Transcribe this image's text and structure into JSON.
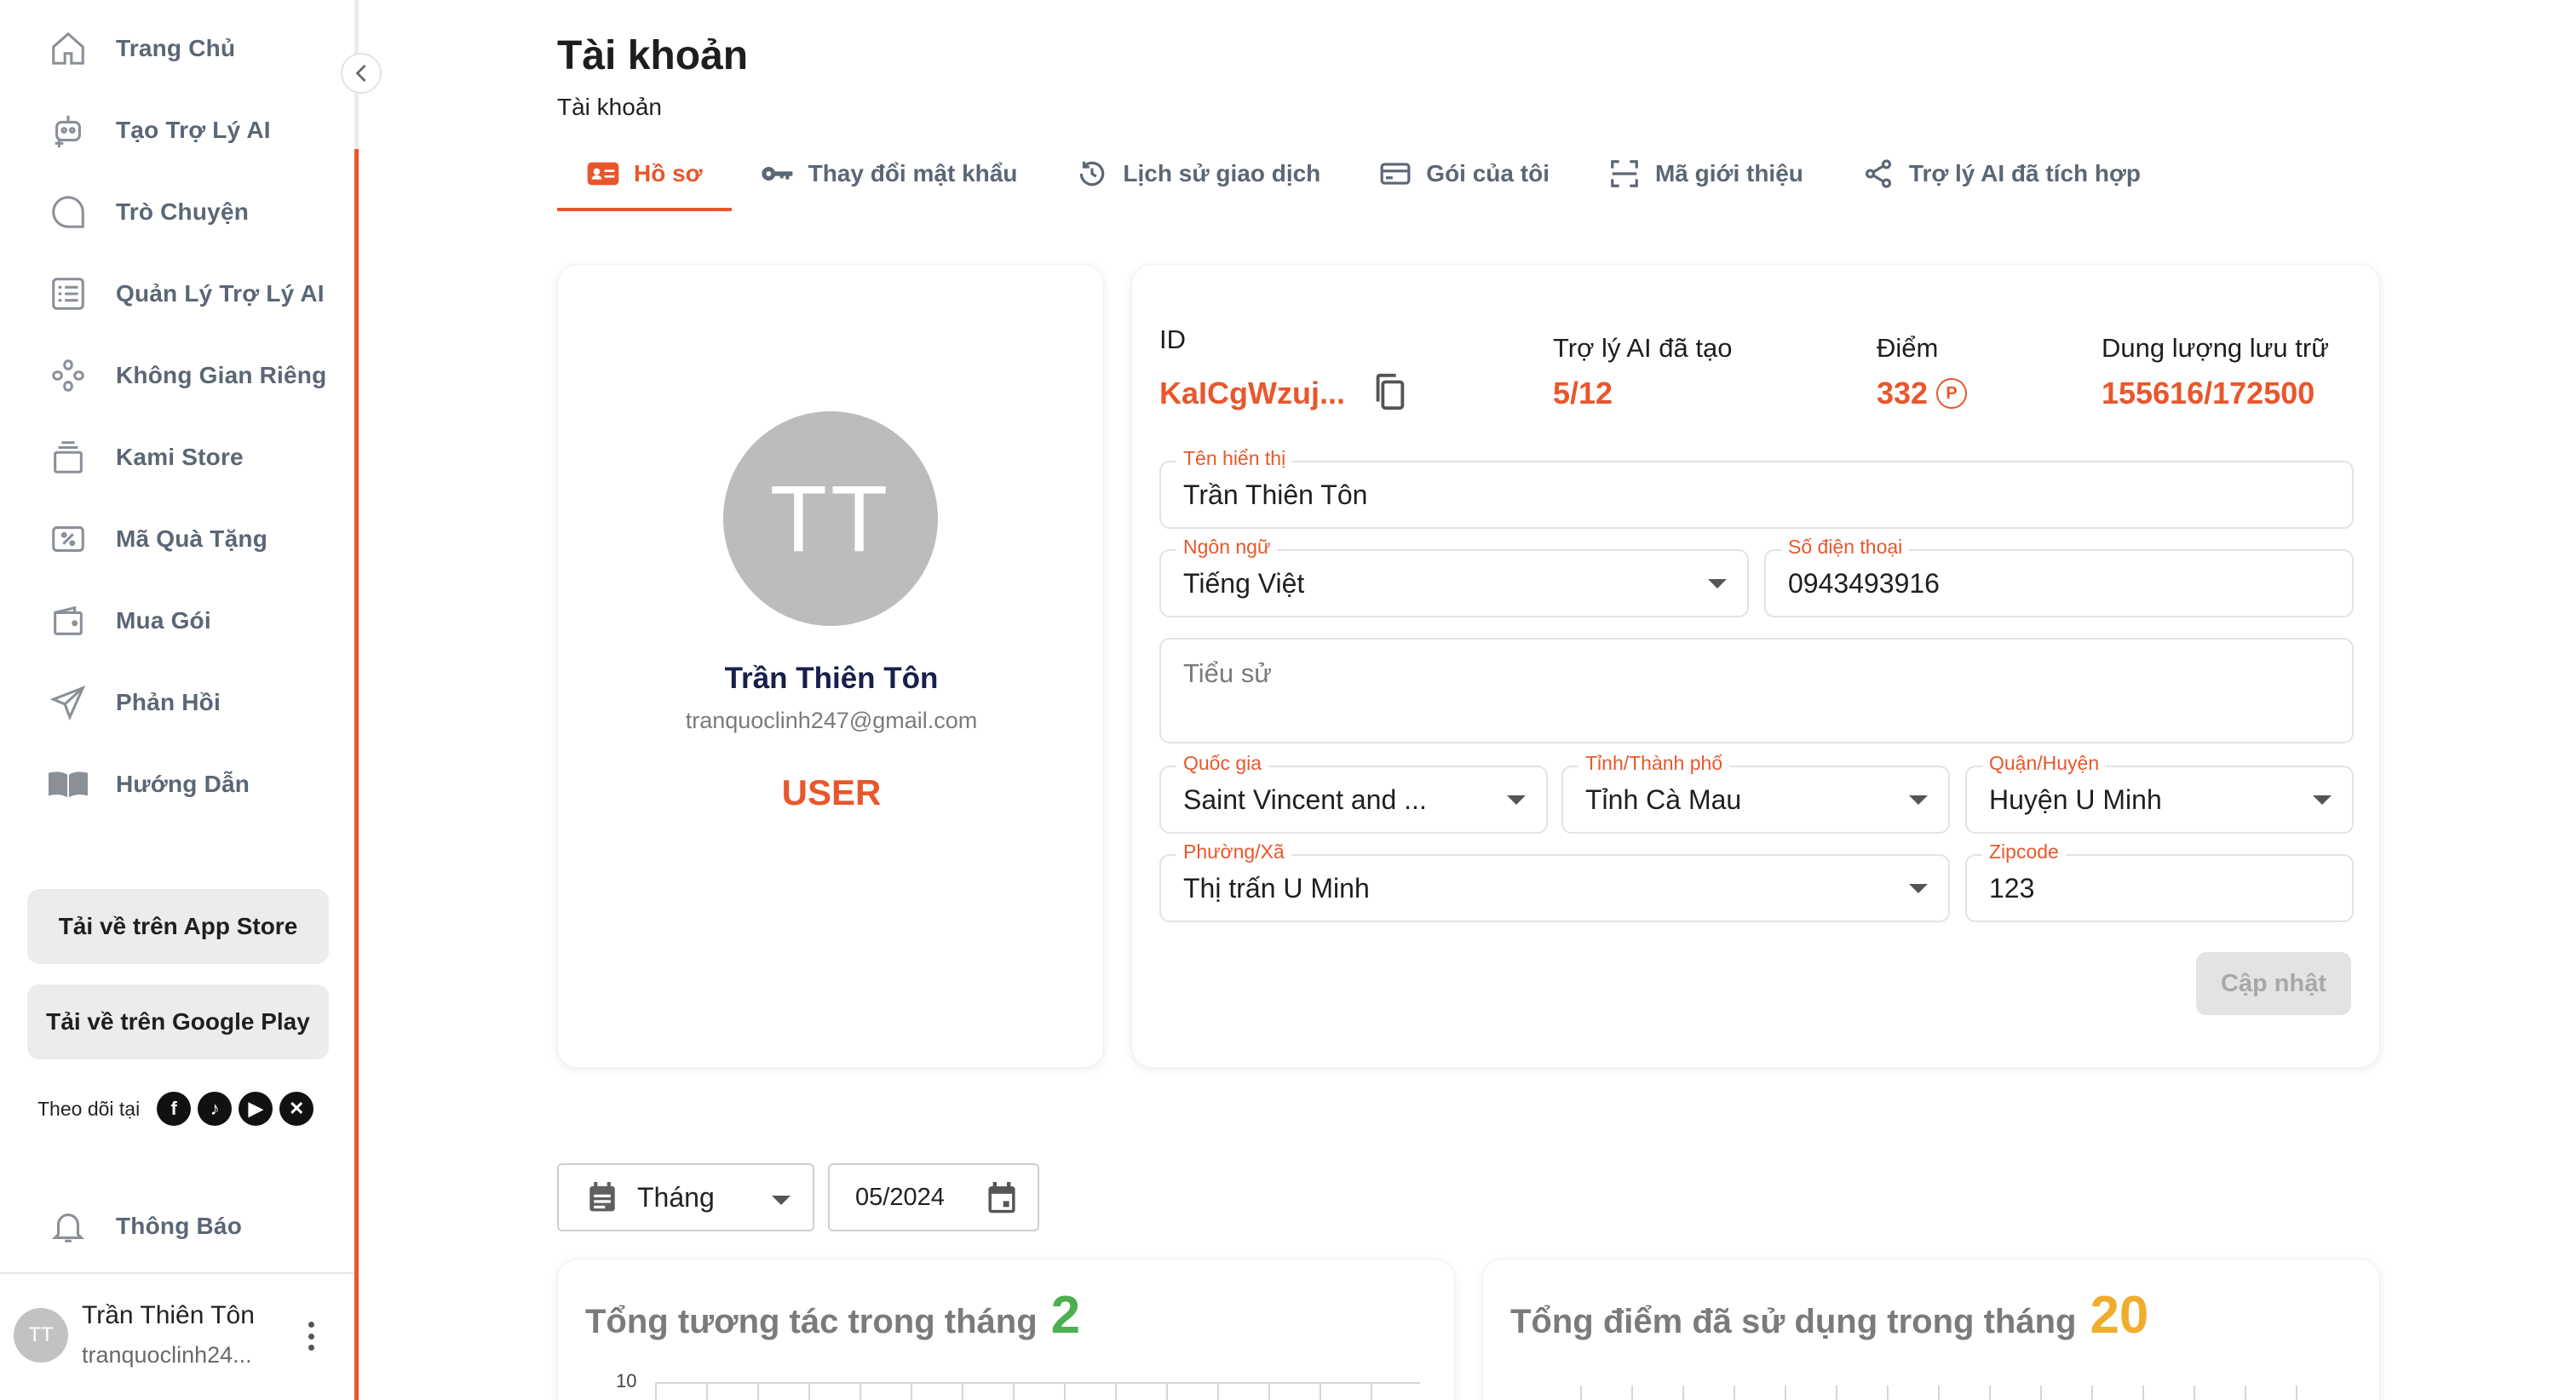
{
  "sidebar": {
    "items": [
      {
        "label": "Trang Chủ",
        "icon": "home-icon"
      },
      {
        "label": "Tạo Trợ Lý AI",
        "icon": "robot-add-icon"
      },
      {
        "label": "Trò Chuyện",
        "icon": "chat-bubble-icon"
      },
      {
        "label": "Quản Lý Trợ Lý AI",
        "icon": "list-manage-icon"
      },
      {
        "label": "Không Gian Riêng",
        "icon": "private-space-icon"
      },
      {
        "label": "Kami Store",
        "icon": "store-icon"
      },
      {
        "label": "Mã Quà Tặng",
        "icon": "gift-code-icon"
      },
      {
        "label": "Mua Gói",
        "icon": "wallet-icon"
      },
      {
        "label": "Phản Hồi",
        "icon": "send-icon"
      },
      {
        "label": "Hướng Dẫn",
        "icon": "book-icon"
      }
    ],
    "app_store_label": "Tải về trên App Store",
    "google_play_label": "Tải về trên Google Play",
    "follow_label": "Theo dõi tại",
    "social": [
      "facebook-icon",
      "tiktok-icon",
      "youtube-icon",
      "x-icon"
    ],
    "notifications_label": "Thông Báo",
    "user": {
      "initials": "TT",
      "name": "Trần Thiên Tôn",
      "email": "tranquoclinh24..."
    }
  },
  "page": {
    "title": "Tài khoản",
    "subtitle": "Tài khoản"
  },
  "tabs": [
    {
      "label": "Hồ sơ",
      "icon": "profile-card-icon",
      "active": true
    },
    {
      "label": "Thay đổi mật khẩu",
      "icon": "key-icon",
      "active": false
    },
    {
      "label": "Lịch sử giao dịch",
      "icon": "history-icon",
      "active": false
    },
    {
      "label": "Gói của tôi",
      "icon": "card-icon",
      "active": false
    },
    {
      "label": "Mã giới thiệu",
      "icon": "scan-icon",
      "active": false
    },
    {
      "label": "Trợ lý AI đã tích hợp",
      "icon": "share-icon",
      "active": false
    }
  ],
  "profile": {
    "initials": "TT",
    "name": "Trần Thiên Tôn",
    "email": "tranquoclinh247@gmail.com",
    "role": "USER"
  },
  "stats": {
    "id_label": "ID",
    "id_value": "KaICgWzuj...",
    "assistants_label": "Trợ lý AI đã tạo",
    "assistants_value": "5/12",
    "points_label": "Điểm",
    "points_value": "332",
    "points_symbol": "P",
    "storage_label": "Dung lượng lưu trữ",
    "storage_value": "155616/172500"
  },
  "form": {
    "display_name": {
      "label": "Tên hiển thị",
      "value": "Trần Thiên Tôn"
    },
    "language": {
      "label": "Ngôn ngữ",
      "value": "Tiếng Việt"
    },
    "phone": {
      "label": "Số điện thoại",
      "value": "0943493916"
    },
    "bio": {
      "placeholder": "Tiểu sử"
    },
    "country": {
      "label": "Quốc gia",
      "value": "Saint Vincent and ..."
    },
    "province": {
      "label": "Tỉnh/Thành phố",
      "value": "Tỉnh Cà Mau"
    },
    "district": {
      "label": "Quận/Huyện",
      "value": "Huyện U Minh"
    },
    "ward": {
      "label": "Phường/Xã",
      "value": "Thị trấn U Minh"
    },
    "zipcode": {
      "label": "Zipcode",
      "value": "123"
    },
    "update_label": "Cập nhật"
  },
  "filters": {
    "period": "Tháng",
    "date": "05/2024"
  },
  "charts": {
    "interactions": {
      "title": "Tổng tương tác trong tháng",
      "value": "2",
      "color": "#4caf50",
      "y_tick": "10"
    },
    "points_used": {
      "title": "Tổng điểm đã sử dụng trong tháng",
      "value": "20",
      "color": "#f0ad2e"
    }
  },
  "colors": {
    "accent": "#e8572c"
  }
}
